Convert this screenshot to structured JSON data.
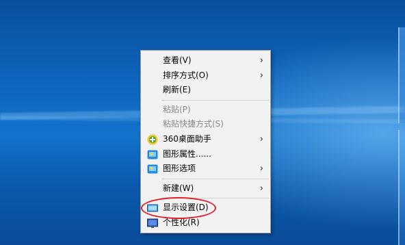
{
  "menu": {
    "items": [
      {
        "label": "查看(V)",
        "submenu": true
      },
      {
        "label": "排序方式(O)",
        "submenu": true
      },
      {
        "label": "刷新(E)"
      },
      {
        "label": "粘贴(P)",
        "disabled": true
      },
      {
        "label": "粘贴快捷方式(S)",
        "disabled": true
      },
      {
        "label": "360桌面助手",
        "icon": "360-assistant-icon",
        "submenu": true
      },
      {
        "label": "图形属性......",
        "icon": "graphics-properties-icon"
      },
      {
        "label": "图形选项",
        "icon": "graphics-options-icon",
        "submenu": true
      },
      {
        "label": "新建(W)",
        "submenu": true
      },
      {
        "label": "显示设置(D)",
        "icon": "display-settings-icon",
        "highlighted": true
      },
      {
        "label": "个性化(R)",
        "icon": "personalize-icon"
      }
    ]
  },
  "colors": {
    "desktop_blue": "#0f69c2",
    "menu_bg": "#f2f2f2",
    "highlight_circle": "#e0202a"
  }
}
